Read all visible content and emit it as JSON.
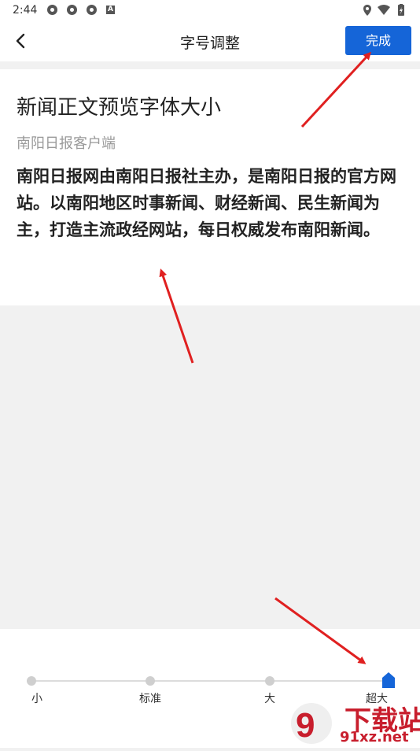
{
  "status_bar": {
    "time": "2:44",
    "app_icons": [
      "app-icon",
      "app-icon",
      "app-icon",
      "a-icon"
    ],
    "right_icons": [
      "location-icon",
      "wifi-icon",
      "battery-icon"
    ]
  },
  "header": {
    "back_icon": "chevron-left-icon",
    "title": "字号调整",
    "done_label": "完成"
  },
  "preview": {
    "title": "新闻正文预览字体大小",
    "source": "南阳日报客户端",
    "body": "南阳日报网由南阳日报社主办，是南阳日报的官方网站。以南阳地区时事新闻、财经新闻、民生新闻为主，打造主流政经网站，每日权威发布南阳新闻。"
  },
  "font_size_slider": {
    "options": [
      "小",
      "标准",
      "大",
      "超大"
    ],
    "selected_index": 3
  },
  "colors": {
    "accent": "#1565d8",
    "annotation_arrow": "#e02020",
    "watermark": "#c81e2d"
  },
  "watermark": {
    "main": "下载站",
    "url": "91xz.net"
  }
}
